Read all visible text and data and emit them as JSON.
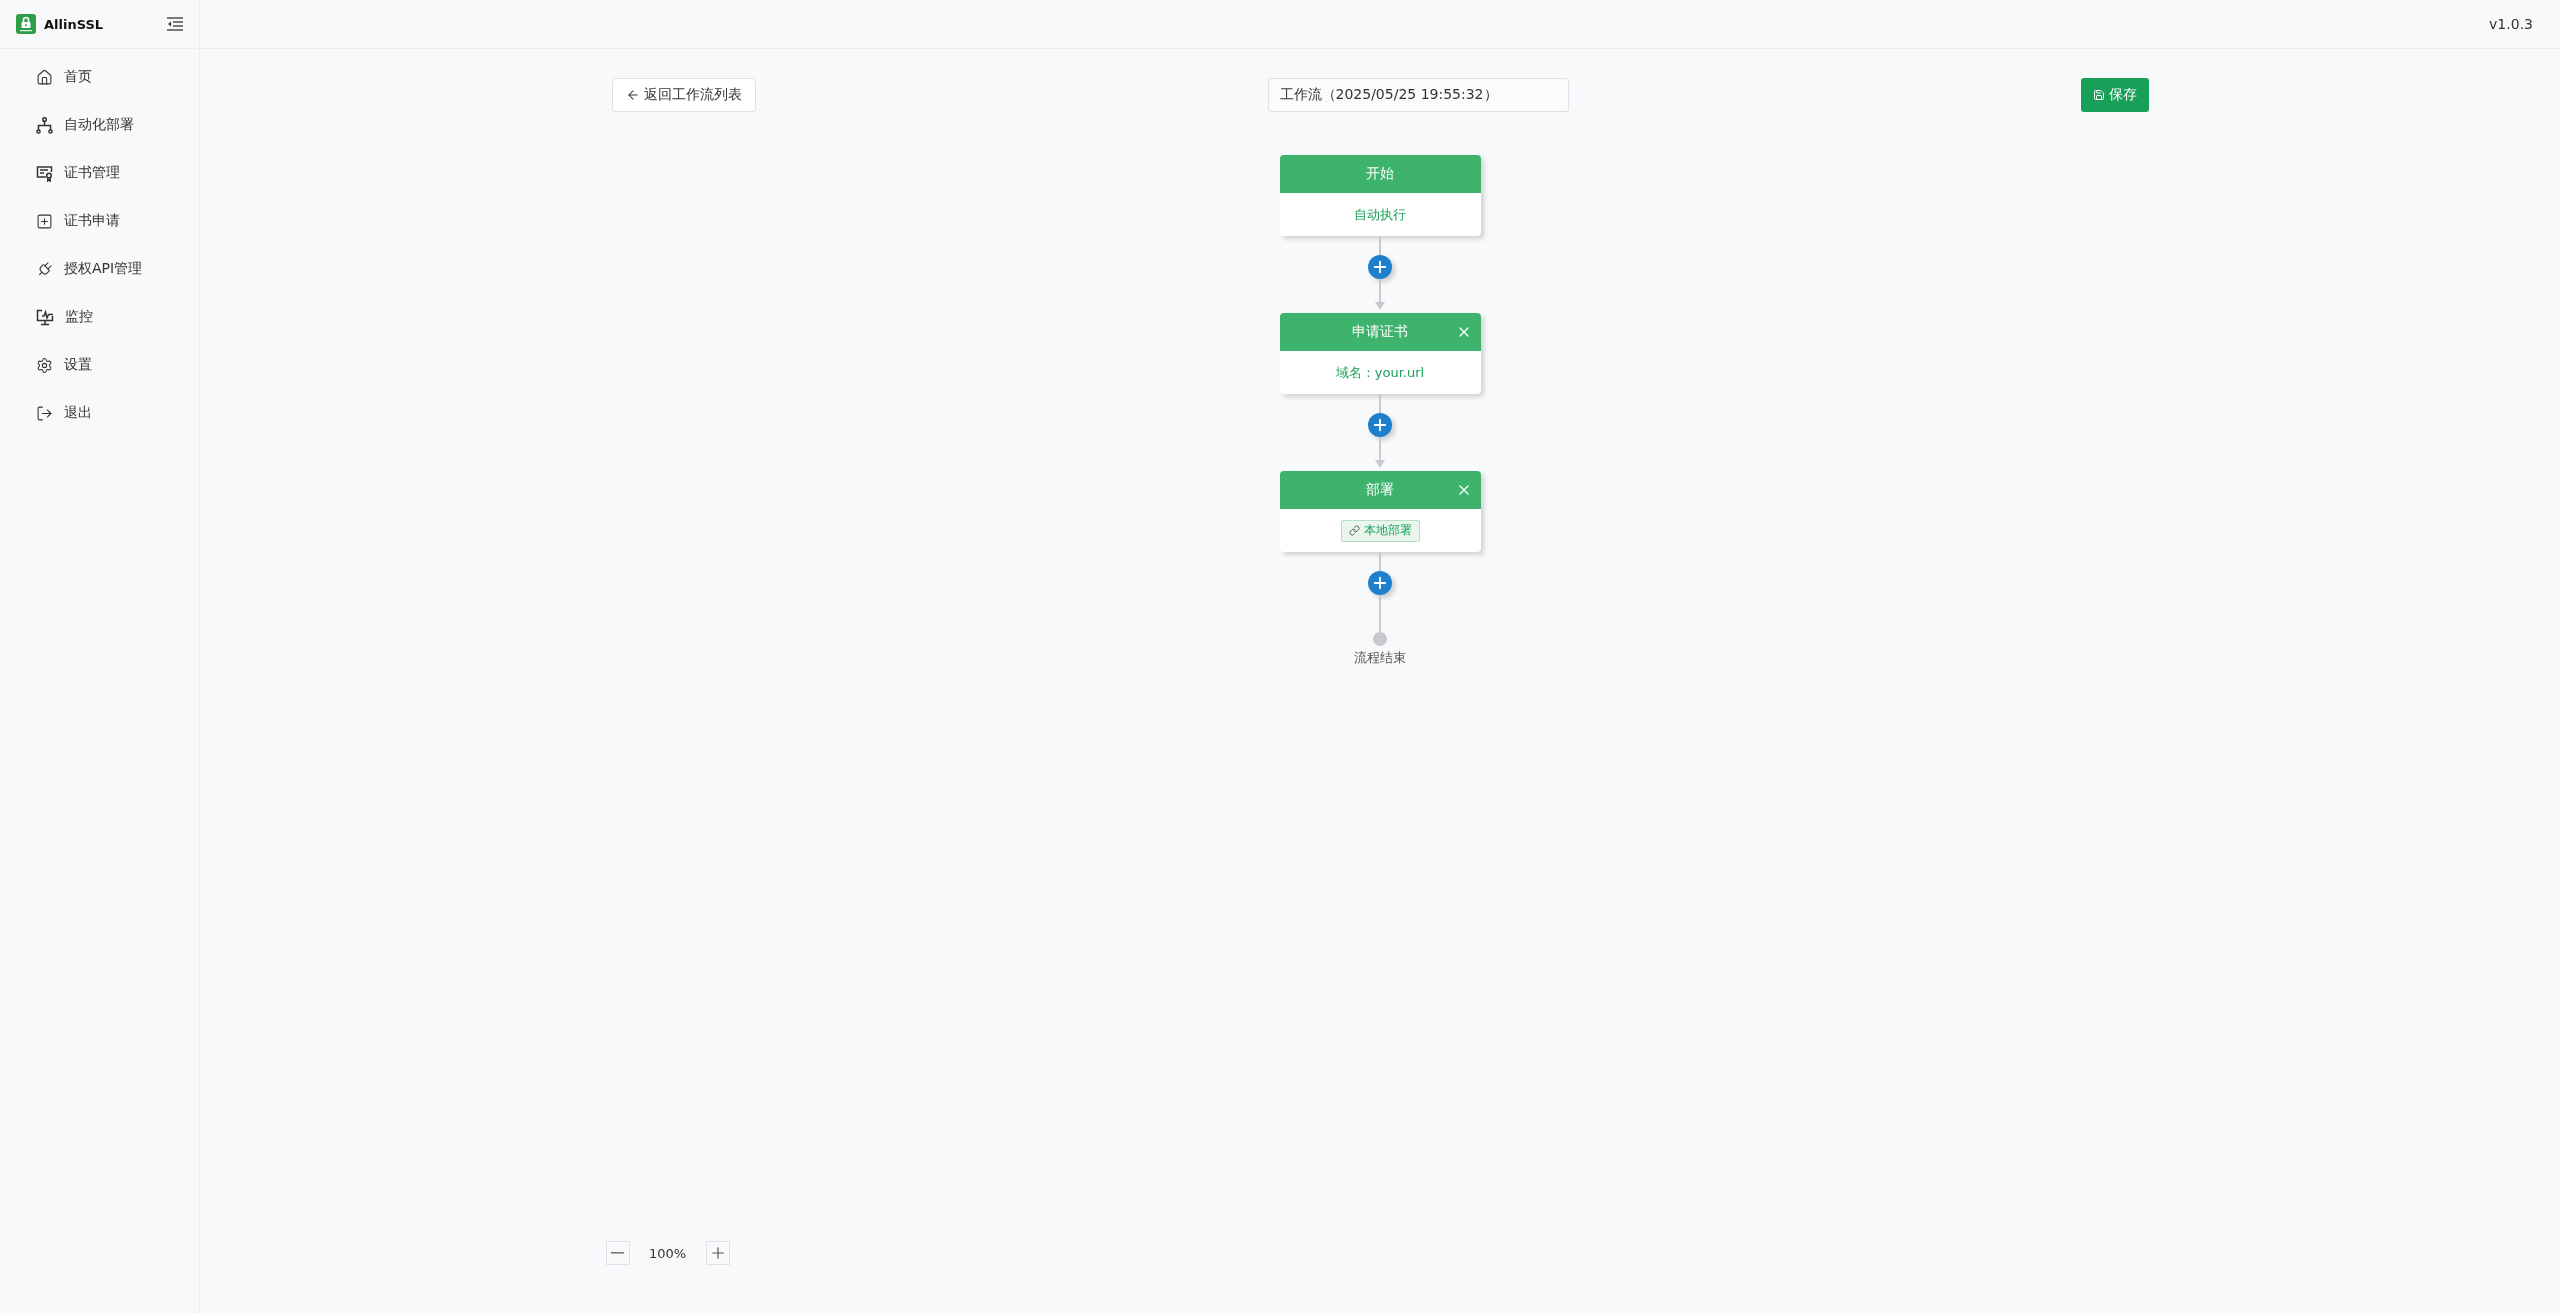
{
  "sidebar": {
    "brand": "AllinSSL",
    "items": [
      {
        "label": "首页",
        "selected": false
      },
      {
        "label": "自动化部署",
        "selected": false
      },
      {
        "label": "证书管理",
        "selected": false
      },
      {
        "label": "证书申请",
        "selected": false
      },
      {
        "label": "授权API管理",
        "selected": false
      },
      {
        "label": "监控",
        "selected": false
      },
      {
        "label": "设置",
        "selected": false
      },
      {
        "label": "退出",
        "selected": false
      }
    ]
  },
  "top_bar": {
    "version": "v1.0.3"
  },
  "toolbar": {
    "back_button": "返回工作流列表",
    "title_field": {
      "value": "工作流（2025/05/25 19:55:32）"
    },
    "save_button": "保存"
  },
  "workflow": {
    "nodes": [
      {
        "kind": "start",
        "title": "开始",
        "body": "自动执行",
        "removable": false
      },
      {
        "kind": "apply",
        "title": "申请证书",
        "body": "域名：your.url",
        "removable": true
      },
      {
        "kind": "deploy",
        "title": "部署",
        "tag": "本地部署",
        "removable": true
      }
    ],
    "end_label": "流程结束"
  },
  "zoom_controls": {
    "zoom": "100%"
  }
}
